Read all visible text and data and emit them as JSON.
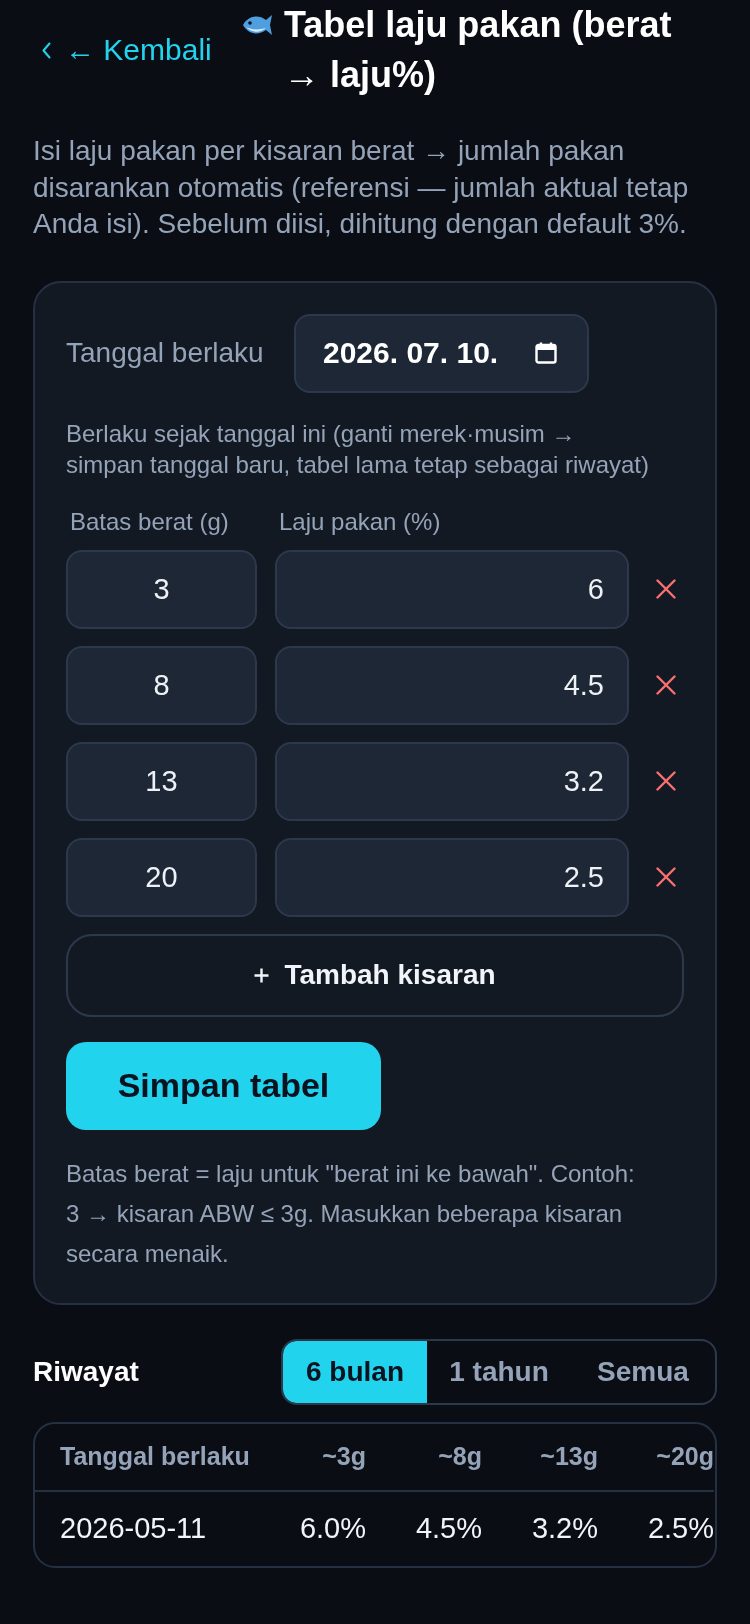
{
  "header": {
    "back_link": "← Kembali",
    "title": "Tabel laju pakan (berat → laju%)"
  },
  "intro": "Isi laju pakan per kisaran berat → jumlah pakan disarankan otomatis (referensi — jumlah aktual tetap Anda isi). Sebelum diisi, dihitung dengan default 3%.",
  "form": {
    "date": {
      "label": "Tanggal berlaku",
      "value": "2026. 07. 10."
    },
    "hint": "Berlaku sejak tanggal ini (ganti merek·musim → simpan tanggal baru, tabel lama tetap sebagai riwayat)",
    "columns": [
      "Batas berat (g)",
      "Laju pakan (%)"
    ],
    "rows": [
      {
        "weight": "3",
        "rate": "6"
      },
      {
        "weight": "8",
        "rate": "4.5"
      },
      {
        "weight": "13",
        "rate": "3.2"
      },
      {
        "weight": "20",
        "rate": "2.5"
      }
    ],
    "add_button": "Tambah kisaran",
    "save_button": "Simpan tabel",
    "note": "Batas berat = laju untuk \"berat ini ke bawah\". Contoh: 3 → kisaran ABW ≤ 3g. Masukkan beberapa kisaran secara menaik."
  },
  "history": {
    "title": "Riwayat",
    "periods": [
      {
        "label": "6 bulan",
        "selected": true
      },
      {
        "label": "1 tahun",
        "selected": false
      },
      {
        "label": "Semua",
        "selected": false
      }
    ],
    "table": {
      "columns": [
        "Tanggal berlaku",
        "~3g",
        "~8g",
        "~13g",
        "~20g"
      ],
      "rows": [
        [
          "2026-05-11",
          "6.0%",
          "4.5%",
          "3.2%",
          "2.5%"
        ]
      ]
    }
  }
}
